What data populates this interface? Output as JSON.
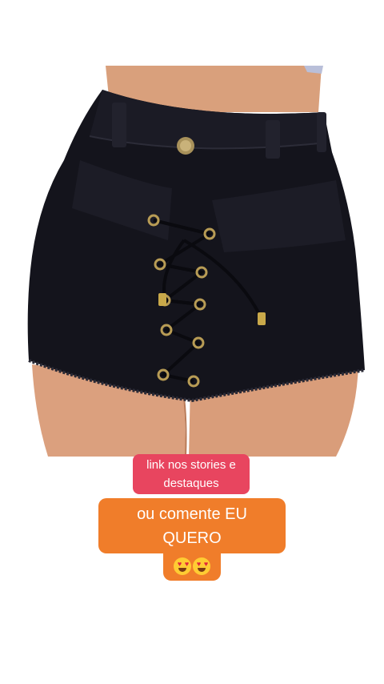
{
  "story": {
    "sticker_link": {
      "line1": "link nos stories e",
      "line2": "destaques"
    },
    "sticker_comment": {
      "line1": "ou comente EU",
      "line2": "QUERO"
    },
    "emojis": [
      "😍",
      "😍"
    ]
  },
  "colors": {
    "pink_sticker": "#e8455f",
    "orange_sticker": "#f07d2a",
    "shorts": "#14141c"
  },
  "icons": {
    "product_image": "black-denim-lace-up-shorts",
    "emoji": "heart-eyes"
  }
}
